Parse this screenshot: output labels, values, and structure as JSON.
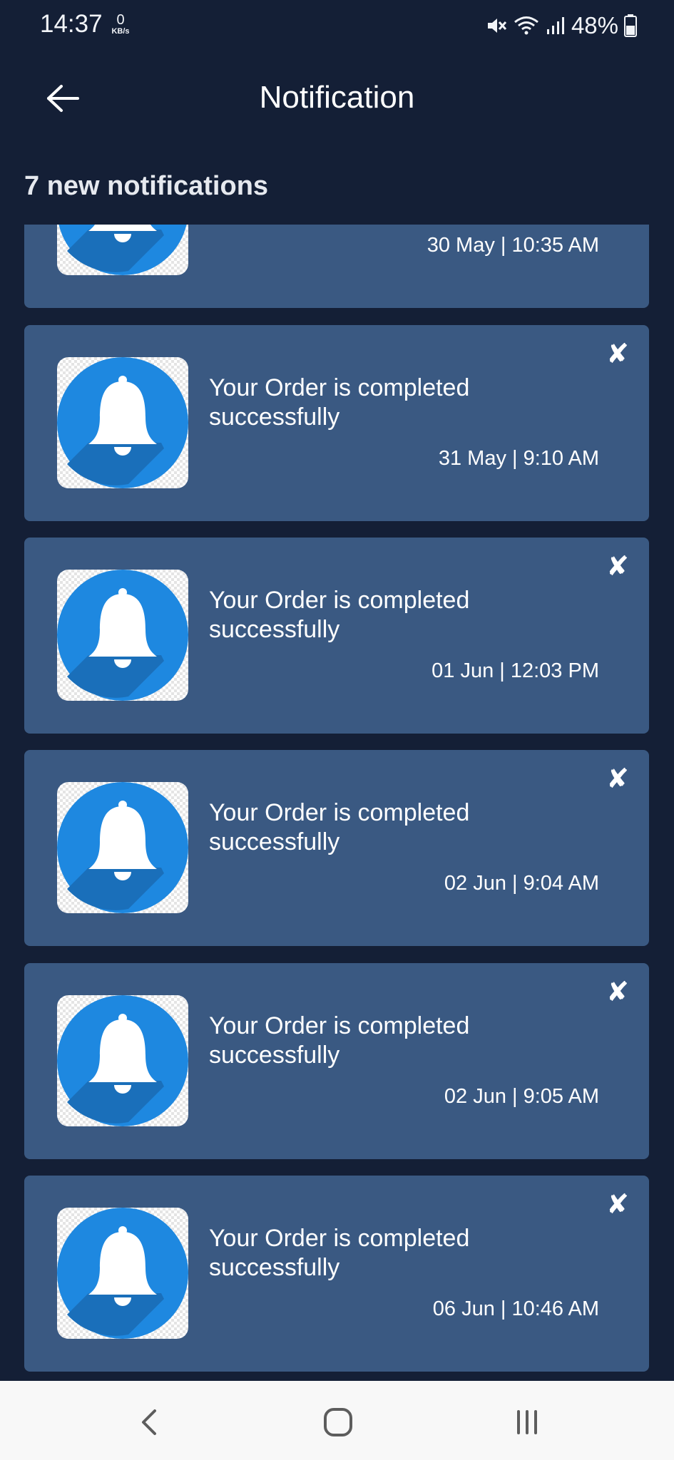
{
  "status_bar": {
    "time": "14:37",
    "net_speed_value": "0",
    "net_speed_unit": "KB/s",
    "battery_percent": "48%",
    "icons": [
      "mute-icon",
      "wifi-icon",
      "signal-icon",
      "battery-icon"
    ]
  },
  "header": {
    "title": "Notification",
    "back_icon": "arrow-left-icon"
  },
  "summary": {
    "count_label": "7 new notifications"
  },
  "notifications": [
    {
      "message": "",
      "datetime": "30 May | 10:35 AM",
      "icon": "bell-icon"
    },
    {
      "message": "Your Order is completed successfully",
      "datetime": "31 May | 9:10 AM",
      "icon": "bell-icon",
      "close": "✘"
    },
    {
      "message": "Your Order is completed successfully",
      "datetime": "01 Jun | 12:03 PM",
      "icon": "bell-icon",
      "close": "✘"
    },
    {
      "message": "Your Order is completed successfully",
      "datetime": "02 Jun | 9:04 AM",
      "icon": "bell-icon",
      "close": "✘"
    },
    {
      "message": "Your Order is completed successfully",
      "datetime": "02 Jun | 9:05 AM",
      "icon": "bell-icon",
      "close": "✘"
    },
    {
      "message": "Your Order is completed successfully",
      "datetime": "06 Jun | 10:46 AM",
      "icon": "bell-icon",
      "close": "✘"
    }
  ],
  "nav_bar": {
    "icons": [
      "back-nav-icon",
      "home-nav-icon",
      "recents-nav-icon"
    ]
  },
  "colors": {
    "background": "#141f36",
    "card": "#3a5982",
    "bell_circle": "#1e88e0",
    "nav_bar": "#f8f8f8"
  }
}
